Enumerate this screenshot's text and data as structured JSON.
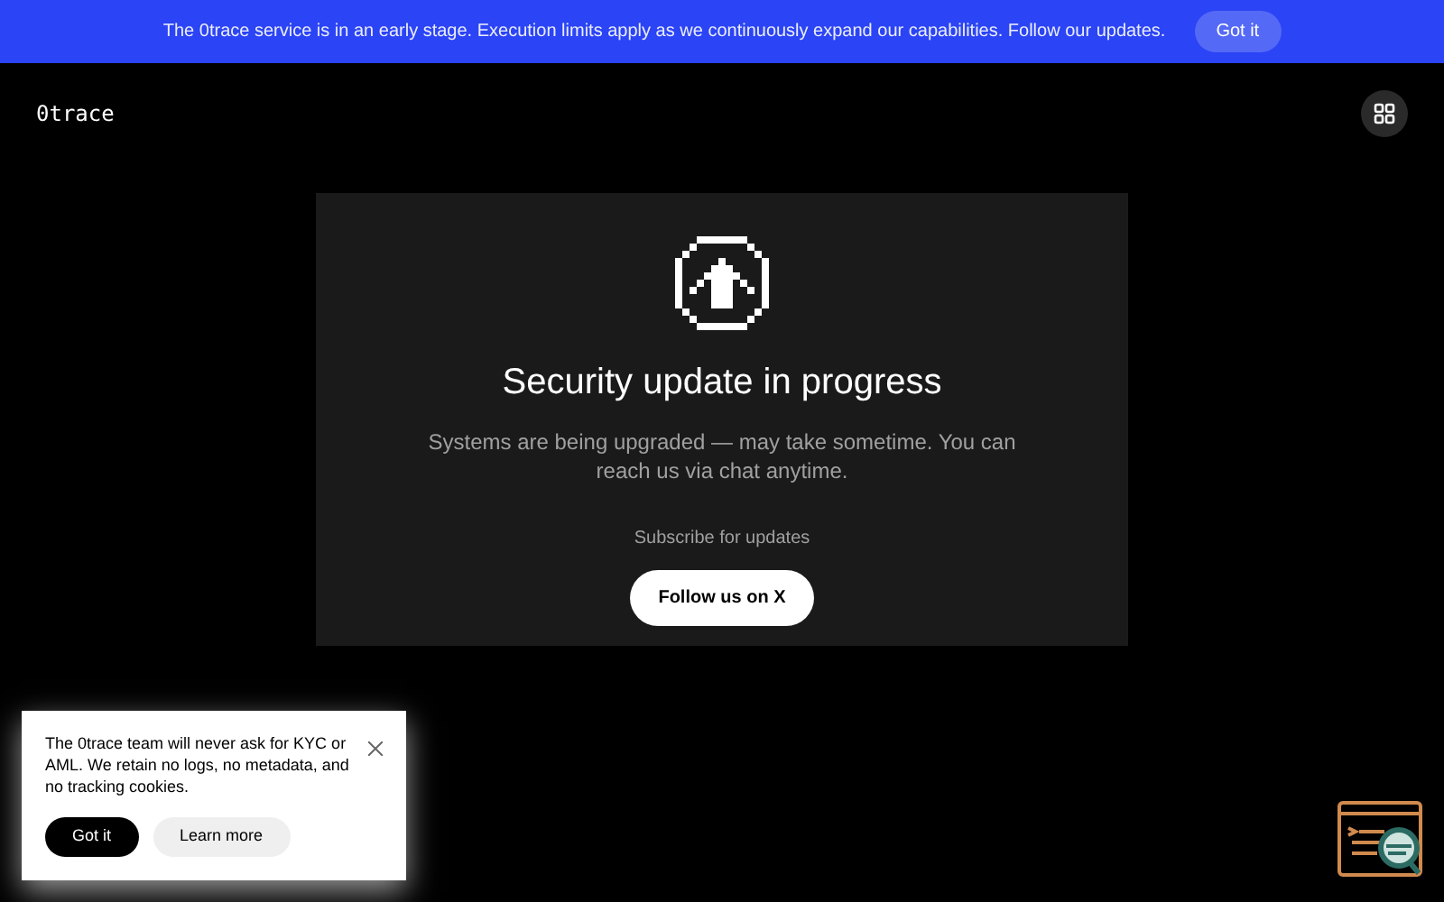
{
  "banner": {
    "text": "The 0trace service is in an early stage. Execution limits apply as we continuously expand our capabilities. Follow our updates.",
    "button": "Got it"
  },
  "header": {
    "logo": "0trace"
  },
  "card": {
    "title": "Security update in progress",
    "description": "Systems are being upgraded — may take sometime. You can reach us via chat anytime.",
    "subscribe_label": "Subscribe for updates",
    "button": "Follow us on X"
  },
  "cookie_notice": {
    "text": "The 0trace team will never ask for KYC or AML. We retain no logs, no metadata, and no tracking cookies.",
    "buttons": [
      {
        "label": "Got it",
        "kind": "primary"
      },
      {
        "label": "Learn more",
        "kind": "secondary"
      }
    ]
  }
}
